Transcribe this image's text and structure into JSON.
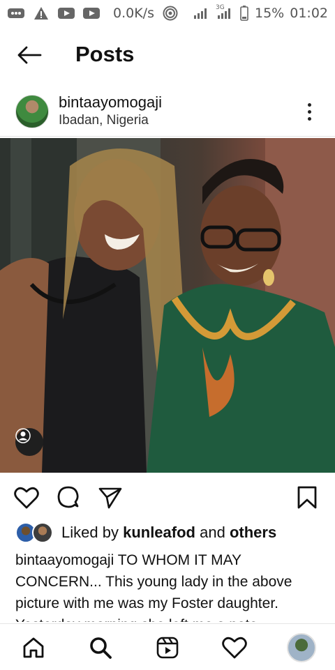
{
  "status_bar": {
    "net_speed": "0.0K/s",
    "battery": "15%",
    "time": "01:02",
    "network_type": "3G",
    "icons": [
      "messages-icon",
      "warning-icon",
      "youtube-icon",
      "youtube-icon",
      "hotspot-icon",
      "signal-icon",
      "signal-icon",
      "battery-icon"
    ]
  },
  "header": {
    "title": "Posts"
  },
  "post": {
    "username": "bintaayomogaji",
    "location": "Ibadan, Nigeria",
    "likes": {
      "prefix": "Liked by",
      "user": "kunleafod",
      "and": "and",
      "others": "others"
    },
    "caption": {
      "username": "bintaayomogaji",
      "text": "TO WHOM IT MAY CONCERN... This young lady in the above picture with me was my Foster daughter. Yesterday morning she left me a note"
    }
  },
  "bottom_nav": {
    "items": [
      "home-icon",
      "search-icon",
      "reels-icon",
      "heart-icon",
      "profile-avatar"
    ]
  },
  "colors": {
    "text": "#111111",
    "muted": "#555555",
    "divider": "#e3e3e3"
  }
}
